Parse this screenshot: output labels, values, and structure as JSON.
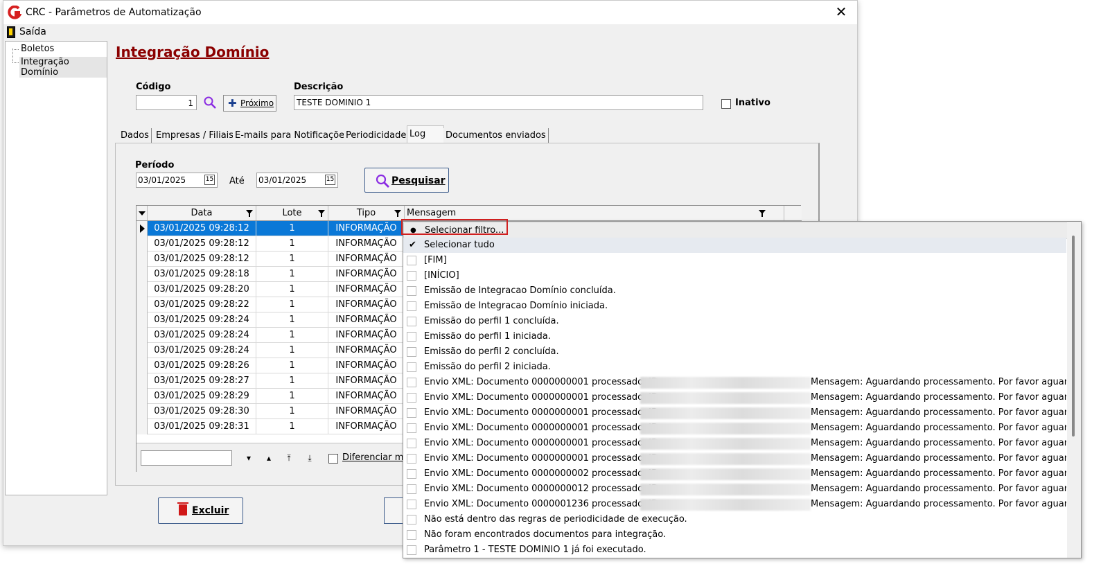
{
  "window": {
    "title": "CRC - Parâmetros de Automatização",
    "close_glyph": "✕"
  },
  "menu": {
    "exit_label": "Saída"
  },
  "tree": {
    "items": [
      "Boletos",
      "Integração Domínio"
    ]
  },
  "page": {
    "title": "Integração Domínio"
  },
  "form": {
    "codigo_label": "Código",
    "codigo_value": "1",
    "next_label": "Próximo",
    "descricao_label": "Descrição",
    "descricao_value": "TESTE DOMINIO 1",
    "inativo_label": "Inativo"
  },
  "tabs": [
    "Dados",
    "Empresas / Filiais",
    "E-mails para Notificações",
    "Periodicidade",
    "Log",
    "Documentos enviados"
  ],
  "active_tab": "Log",
  "log": {
    "periodo_label": "Período",
    "date_from": "03/01/2025",
    "ate_label": "Até",
    "date_to": "03/01/2025",
    "search_label": "Pesquisar",
    "diff_label": "Diferenciar mai"
  },
  "grid": {
    "columns": [
      "Data",
      "Lote",
      "Tipo",
      "Mensagem"
    ],
    "rows": [
      [
        "03/01/2025 09:28:12",
        "1",
        "INFORMAÇÃO"
      ],
      [
        "03/01/2025 09:28:12",
        "1",
        "INFORMAÇÃO"
      ],
      [
        "03/01/2025 09:28:12",
        "1",
        "INFORMAÇÃO"
      ],
      [
        "03/01/2025 09:28:18",
        "1",
        "INFORMAÇÃO"
      ],
      [
        "03/01/2025 09:28:20",
        "1",
        "INFORMAÇÃO"
      ],
      [
        "03/01/2025 09:28:22",
        "1",
        "INFORMAÇÃO"
      ],
      [
        "03/01/2025 09:28:24",
        "1",
        "INFORMAÇÃO"
      ],
      [
        "03/01/2025 09:28:24",
        "1",
        "INFORMAÇÃO"
      ],
      [
        "03/01/2025 09:28:24",
        "1",
        "INFORMAÇÃO"
      ],
      [
        "03/01/2025 09:28:26",
        "1",
        "INFORMAÇÃO"
      ],
      [
        "03/01/2025 09:28:27",
        "1",
        "INFORMAÇÃO"
      ],
      [
        "03/01/2025 09:28:29",
        "1",
        "INFORMAÇÃO"
      ],
      [
        "03/01/2025 09:28:30",
        "1",
        "INFORMAÇÃO"
      ],
      [
        "03/01/2025 09:28:31",
        "1",
        "INFORMAÇÃO"
      ]
    ]
  },
  "buttons": {
    "delete_label": "Excluir"
  },
  "filter_popup": {
    "select_filter": "Selecionar filtro...",
    "select_all": "Selecionar tudo",
    "items": [
      {
        "text": "[FIM]"
      },
      {
        "text": "[INÍCIO]"
      },
      {
        "text": "Emissão de Integracao Domínio concluída."
      },
      {
        "text": "Emissão de Integracao Domínio iniciada."
      },
      {
        "text": "Emissão do perfil 1 concluída."
      },
      {
        "text": "Emissão do perfil 1 iniciada."
      },
      {
        "text": "Emissão do perfil 2 concluída."
      },
      {
        "text": "Emissão do perfil 2 iniciada."
      },
      {
        "text": "Envio XML: Documento 0000000001 processado. ID:",
        "tail": "Mensagem: Aguardando processamento. Por favor aguarde..."
      },
      {
        "text": "Envio XML: Documento 0000000001 processado. ID:",
        "tail": "Mensagem: Aguardando processamento. Por favor aguarde..."
      },
      {
        "text": "Envio XML: Documento 0000000001 processado. ID:",
        "tail": "Mensagem: Aguardando processamento. Por favor aguard..."
      },
      {
        "text": "Envio XML: Documento 0000000001 processado. ID:",
        "tail": "Mensagem: Aguardando processamento. Por favor aguard..."
      },
      {
        "text": "Envio XML: Documento 0000000001 processado. ID:",
        "tail": "Mensagem: Aguardando processamento. Por favor aguard..."
      },
      {
        "text": "Envio XML: Documento 0000000001 processado. ID:",
        "tail": "Mensagem: Aguardando processamento. Por favor aguard..."
      },
      {
        "text": "Envio XML: Documento 0000000002 processado. ID:",
        "tail": "Mensagem: Aguardando processamento. Por favor aguard..."
      },
      {
        "text": "Envio XML: Documento 0000000012 processado. ID:",
        "tail": "Mensagem: Aguardando processamento. Por favor aguard..."
      },
      {
        "text": "Envio XML: Documento 0000001236 processado. ID:",
        "tail": "Mensagem: Aguardando processamento. Por favor aguarde..."
      },
      {
        "text": "Não está dentro das regras de periodicidade de execução."
      },
      {
        "text": "Não foram encontrados documentos para integração."
      },
      {
        "text": "Parâmetro 1 - TESTE DOMINIO 1 já foi executado."
      }
    ]
  },
  "colors": {
    "title_red": "#8b0000",
    "selection_blue": "#0a78d7",
    "highlight_red": "#d02020"
  },
  "icons": [
    "app-logo-icon",
    "close-icon",
    "exit-icon",
    "search-icon",
    "plus-icon",
    "calendar-icon",
    "filter-icon",
    "trash-icon",
    "checkmark-icon",
    "bullet-icon"
  ]
}
